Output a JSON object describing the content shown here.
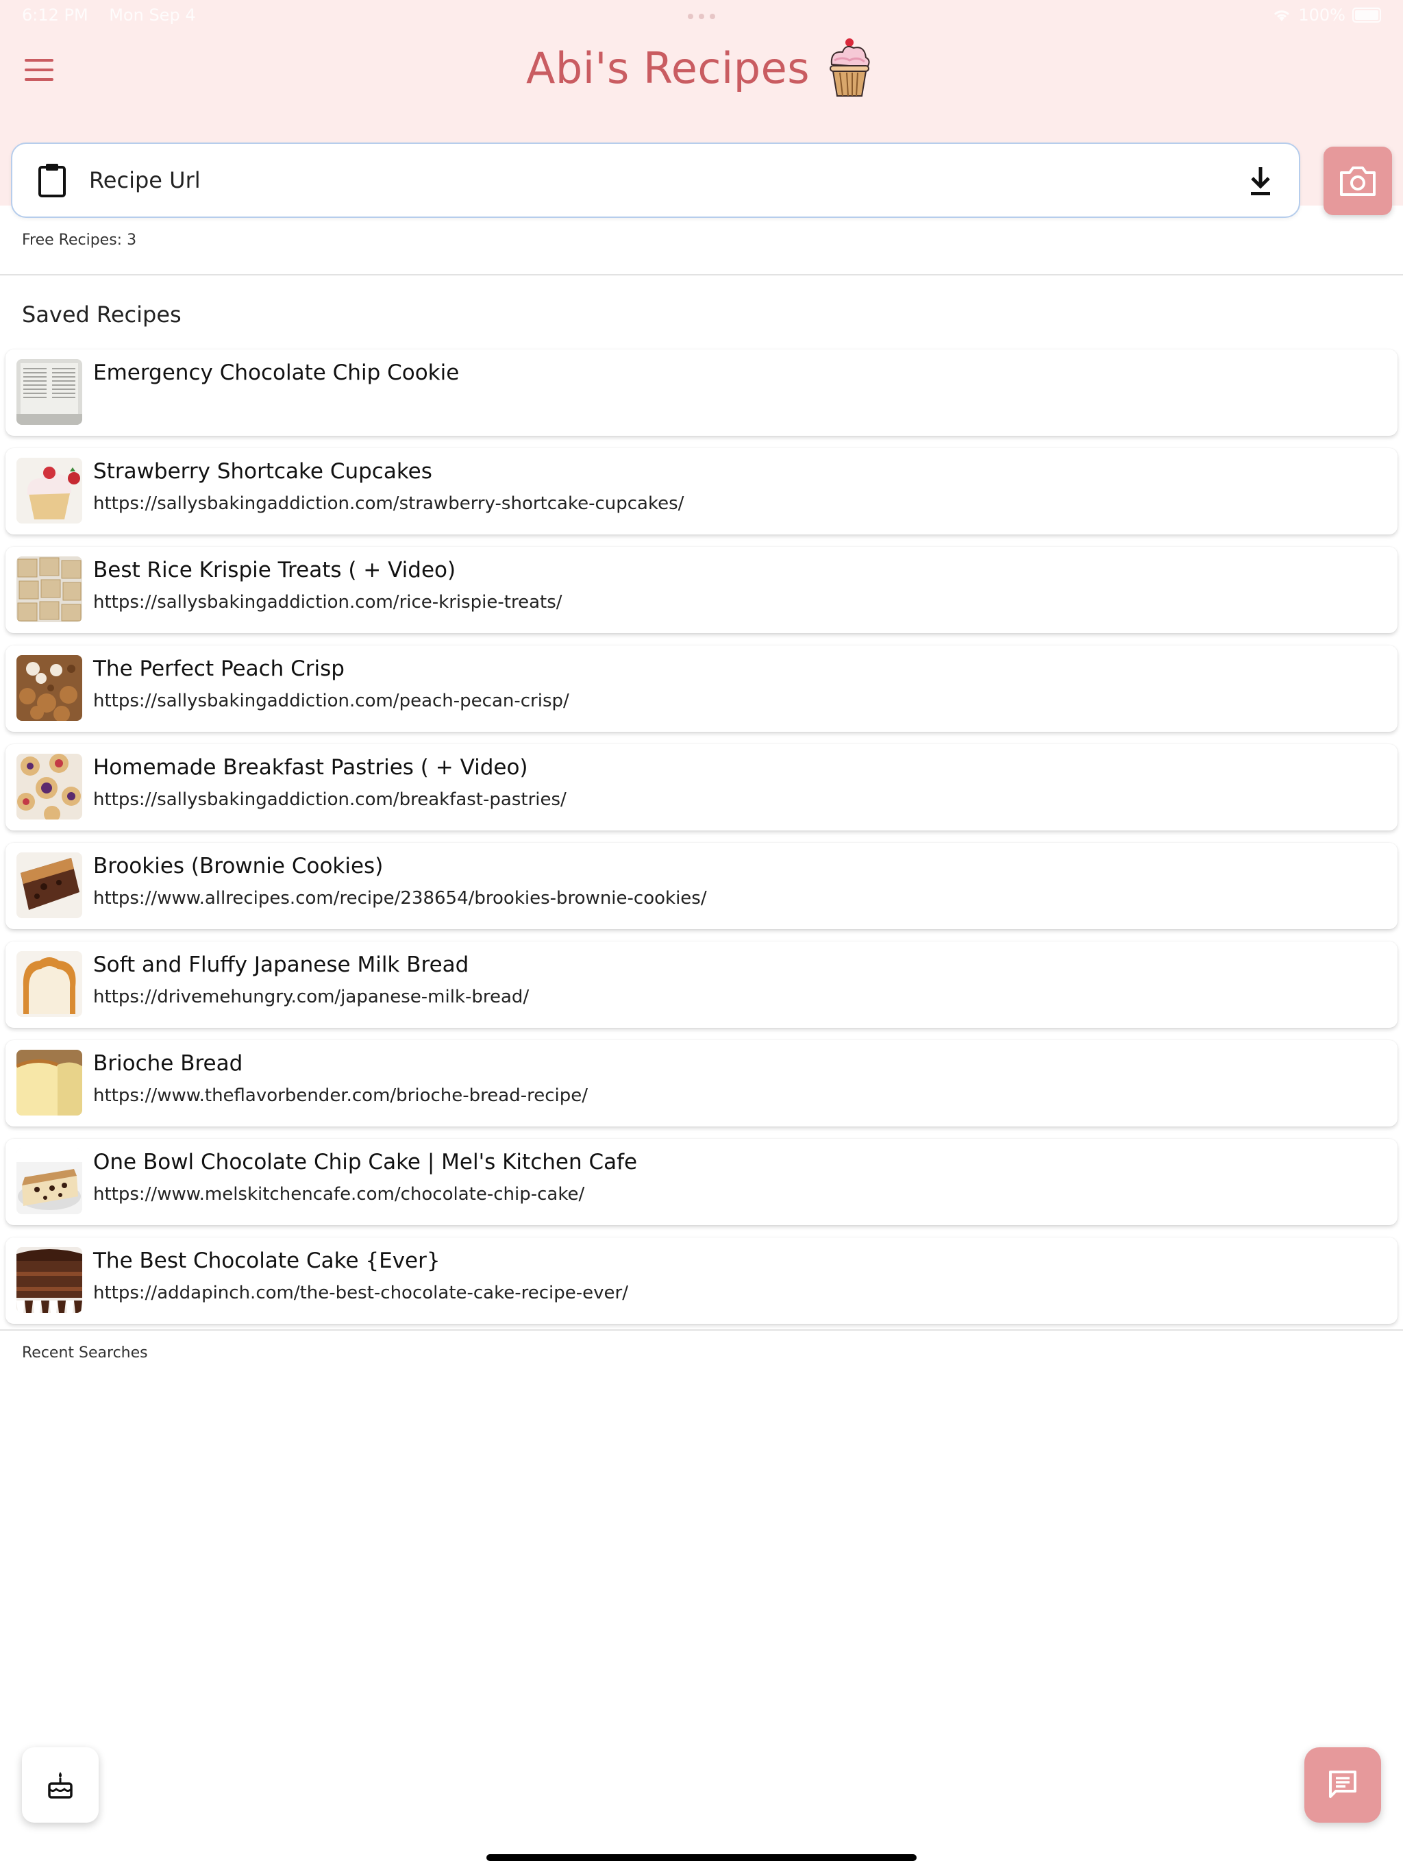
{
  "status_bar": {
    "time": "6:12 PM",
    "date": "Mon Sep 4",
    "battery": "100%"
  },
  "app": {
    "title": "Abi's Recipes"
  },
  "search": {
    "placeholder": "Recipe Url"
  },
  "free_recipes": "Free Recipes: 3",
  "saved_section": {
    "label": "Saved Recipes"
  },
  "recipes": [
    {
      "title": "Emergency Chocolate Chip Cookie",
      "url": "",
      "thumb": "scanned-page"
    },
    {
      "title": "Strawberry Shortcake Cupcakes",
      "url": "https://sallysbakingaddiction.com/strawberry-shortcake-cupcakes/",
      "thumb": "cupcake"
    },
    {
      "title": "Best Rice Krispie Treats ( + Video)",
      "url": "https://sallysbakingaddiction.com/rice-krispie-treats/",
      "thumb": "treats"
    },
    {
      "title": "The Perfect Peach Crisp",
      "url": "https://sallysbakingaddiction.com/peach-pecan-crisp/",
      "thumb": "crisp"
    },
    {
      "title": "Homemade Breakfast Pastries ( + Video)",
      "url": "https://sallysbakingaddiction.com/breakfast-pastries/",
      "thumb": "pastries"
    },
    {
      "title": "Brookies (Brownie Cookies)",
      "url": "https://www.allrecipes.com/recipe/238654/brookies-brownie-cookies/",
      "thumb": "brookies"
    },
    {
      "title": "Soft and Fluffy Japanese Milk Bread",
      "url": "https://drivemehungry.com/japanese-milk-bread/",
      "thumb": "milk-bread"
    },
    {
      "title": "Brioche Bread",
      "url": "https://www.theflavorbender.com/brioche-bread-recipe/",
      "thumb": "brioche"
    },
    {
      "title": "One Bowl Chocolate Chip Cake | Mel's Kitchen Cafe",
      "url": "https://www.melskitchencafe.com/chocolate-chip-cake/",
      "thumb": "chip-cake"
    },
    {
      "title": "The Best Chocolate Cake  {Ever}",
      "url": "https://addapinch.com/the-best-chocolate-cake-recipe-ever/",
      "thumb": "chocolate-cake"
    }
  ],
  "recent_section": {
    "label": "Recent Searches"
  },
  "colors": {
    "header_bg": "#fdeceb",
    "accent": "#c95c61",
    "button_pink": "#e6999b",
    "input_border": "#b6cdec"
  },
  "icons": {
    "menu": "hamburger-menu-icon",
    "clipboard": "clipboard-icon",
    "download": "download-icon",
    "camera": "camera-icon",
    "cake": "cake-icon",
    "chat": "chat-icon",
    "logo": "cupcake-logo"
  }
}
